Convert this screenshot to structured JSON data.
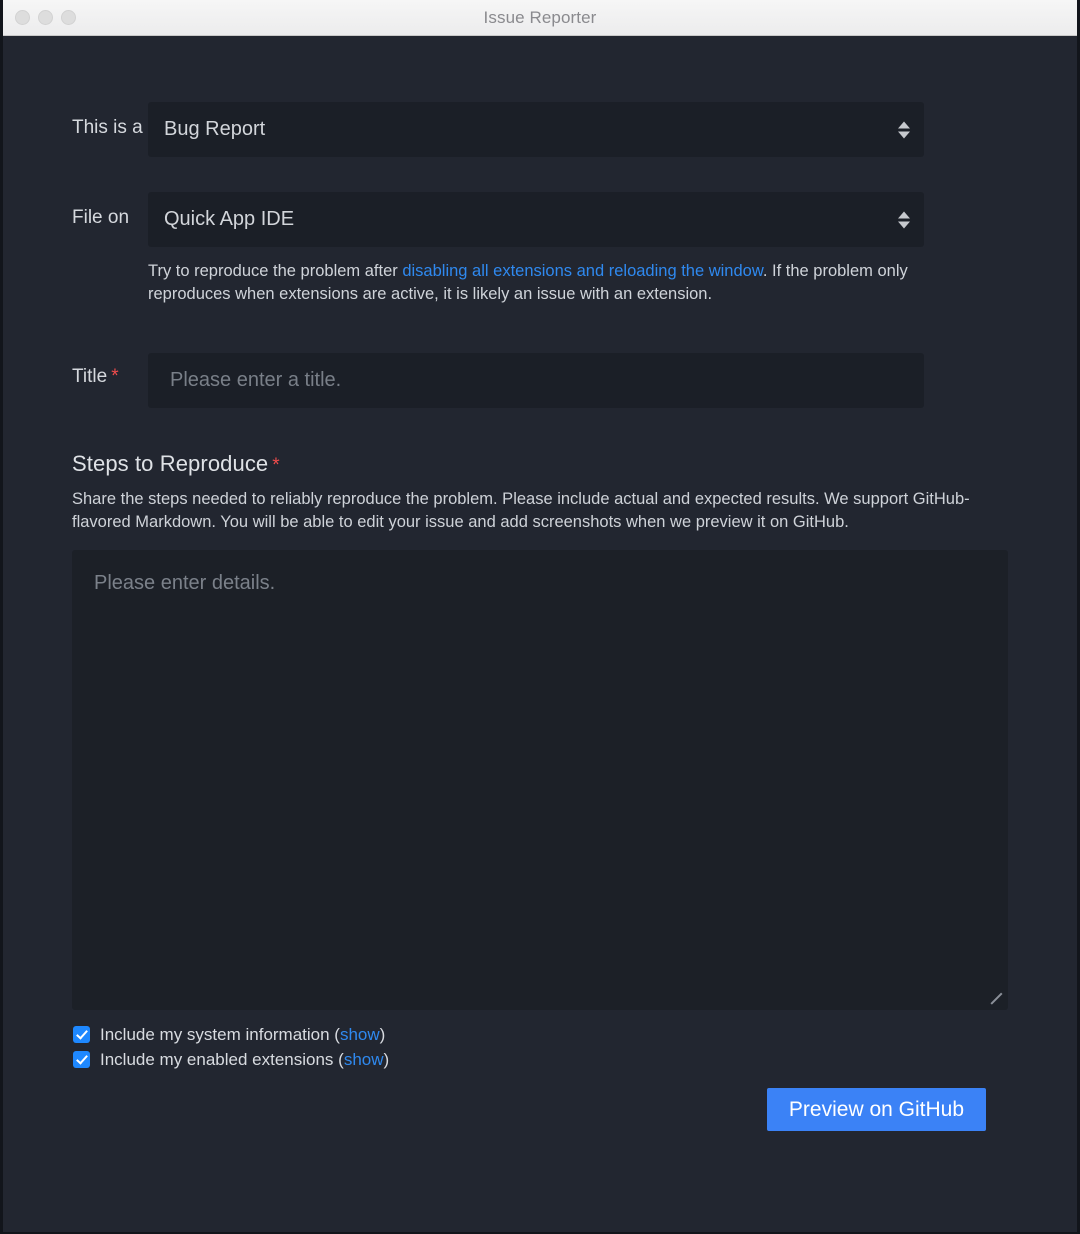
{
  "window": {
    "title": "Issue Reporter",
    "traffic_lights": [
      "close",
      "minimize",
      "zoom"
    ]
  },
  "form": {
    "issue_type": {
      "label": "This is a",
      "value": "Bug Report"
    },
    "file_on": {
      "label": "File on",
      "value": "Quick App IDE",
      "helper_prefix": "Try to reproduce the problem after ",
      "helper_link": "disabling all extensions and reloading the window",
      "helper_suffix": ". If the problem only reproduces when extensions are active, it is likely an issue with an extension."
    },
    "title_field": {
      "label": "Title",
      "required_marker": "*",
      "value": "",
      "placeholder": "Please enter a title."
    },
    "steps": {
      "heading": "Steps to Reproduce",
      "required_marker": "*",
      "description": "Share the steps needed to reliably reproduce the problem. Please include actual and expected results. We support GitHub-flavored Markdown. You will be able to edit your issue and add screenshots when we preview it on GitHub.",
      "value": "",
      "placeholder": "Please enter details."
    },
    "checkboxes": [
      {
        "label": "Include my system information (",
        "link": "show",
        "suffix": ")",
        "checked": true
      },
      {
        "label": "Include my enabled extensions (",
        "link": "show",
        "suffix": ")",
        "checked": true
      }
    ],
    "submit_label": "Preview on GitHub"
  },
  "colors": {
    "accent": "#3b82f6",
    "link": "#2f89ef",
    "required": "#f14c4c",
    "background": "#222630",
    "field_background": "#1b1f27",
    "checkbox": "#1e88ff"
  }
}
